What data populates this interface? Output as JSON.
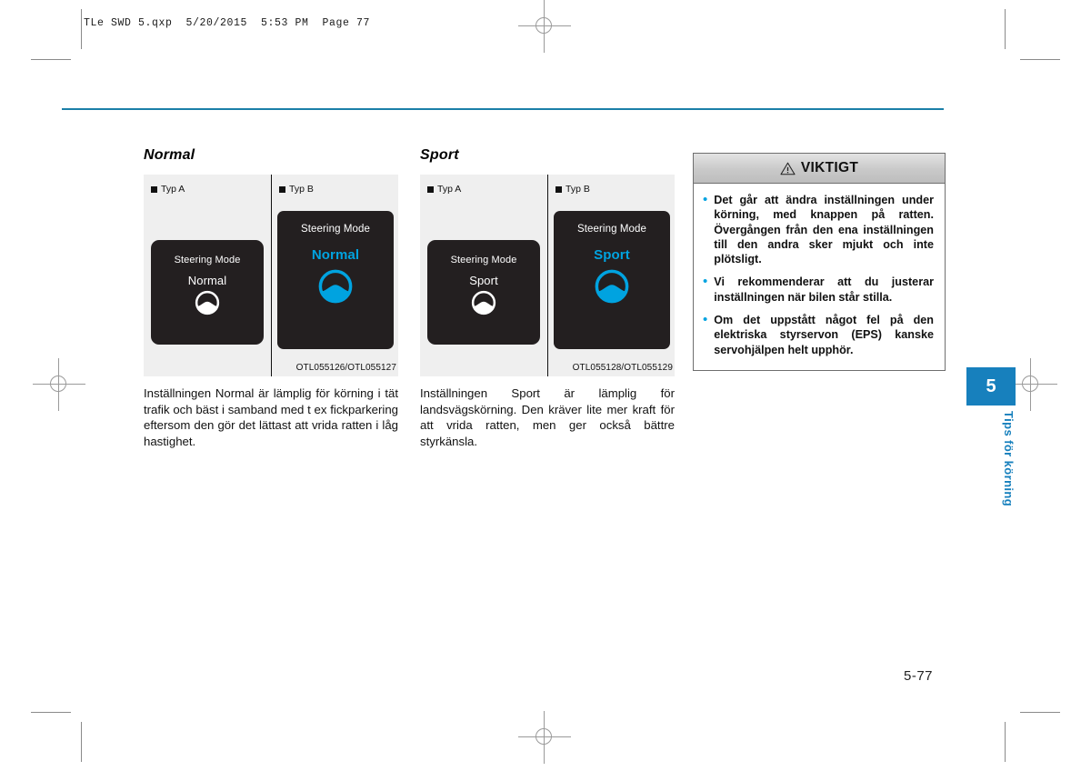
{
  "print_header": "TLe SWD 5.qxp  5/20/2015  5:53 PM  Page 77",
  "accent_blue": "#00a3e0",
  "rule_blue": "#1b7fa8",
  "tab_blue": "#1780bd",
  "sections": [
    {
      "title": "Normal",
      "figure": {
        "type_a_label": "Typ A",
        "type_b_label": "Typ B",
        "screen_title": "Steering Mode",
        "mode_label": "Normal",
        "caption": "OTL055126/OTL055127"
      },
      "body": "Inställningen Normal är lämplig för körning i tät trafik och bäst i samband med t ex fickparkering eftersom den gör det lättast att vrida ratten i låg hastighet."
    },
    {
      "title": "Sport",
      "figure": {
        "type_a_label": "Typ A",
        "type_b_label": "Typ B",
        "screen_title": "Steering Mode",
        "mode_label": "Sport",
        "caption": "OTL055128/OTL055129"
      },
      "body": "Inställningen Sport är lämplig för landsvägskörning. Den kräver lite mer kraft för att vrida ratten, men ger också bättre styrkänsla."
    }
  ],
  "notice": {
    "title": "VIKTIGT",
    "icon": "warning-triangle-icon",
    "items": [
      "Det går att ändra inställningen under körning, med knappen på ratten. Övergången från den ena inställningen till den andra sker mjukt och inte plötsligt.",
      "Vi rekommenderar att du justerar inställningen när bilen står stilla.",
      "Om det uppstått något fel på den elektriska styrservon (EPS) kanske servohjälpen helt upphör."
    ]
  },
  "chapter": {
    "number": "5",
    "label": "Tips för körning"
  },
  "page_number": "5-77"
}
